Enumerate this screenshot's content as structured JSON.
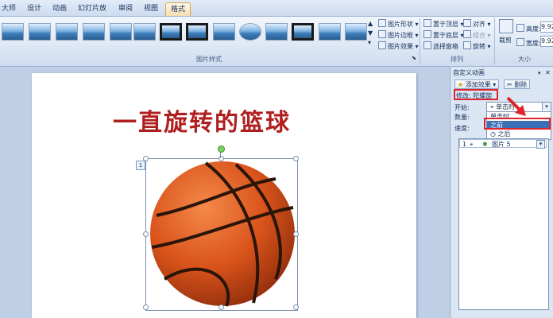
{
  "tabs": [
    {
      "label": "大师"
    },
    {
      "label": "设计"
    },
    {
      "label": "动画"
    },
    {
      "label": "幻灯片放映"
    },
    {
      "label": "审阅"
    },
    {
      "label": "视图"
    },
    {
      "label": "格式",
      "active": true
    }
  ],
  "ribbon": {
    "picture_styles_label": "图片样式",
    "picture_shape": "图片形状",
    "picture_border": "图片边框",
    "picture_effects": "图片效果",
    "bring_forward": "置于顶层",
    "send_backward": "置于底层",
    "selection_pane": "选择窗格",
    "align": "对齐",
    "group": "组合",
    "rotate": "旋转",
    "arrange_label": "排列",
    "crop": "裁剪",
    "height_label": "高度:",
    "height_value": "9.92",
    "width_label": "宽度:",
    "width_value": "9.92",
    "size_label": "大小"
  },
  "slide": {
    "title": "一直旋转的篮球",
    "anim_number": "1"
  },
  "task_pane": {
    "title": "自定义动画",
    "add_effect": "添加效果",
    "remove": "删除",
    "modify": "修改: 陀螺旋",
    "start_label": "开始:",
    "quantity_label": "数量:",
    "speed_label": "速度:",
    "start_value": "单击时",
    "start_options": [
      "单击时",
      "之前",
      "之后"
    ],
    "selected_option": "之前",
    "list_item": {
      "order": "1",
      "name": "图片 5"
    }
  },
  "colors": {
    "accent_red": "#e0242c",
    "title_red": "#b01f1f",
    "selection_blue": "#3d6fb6"
  }
}
